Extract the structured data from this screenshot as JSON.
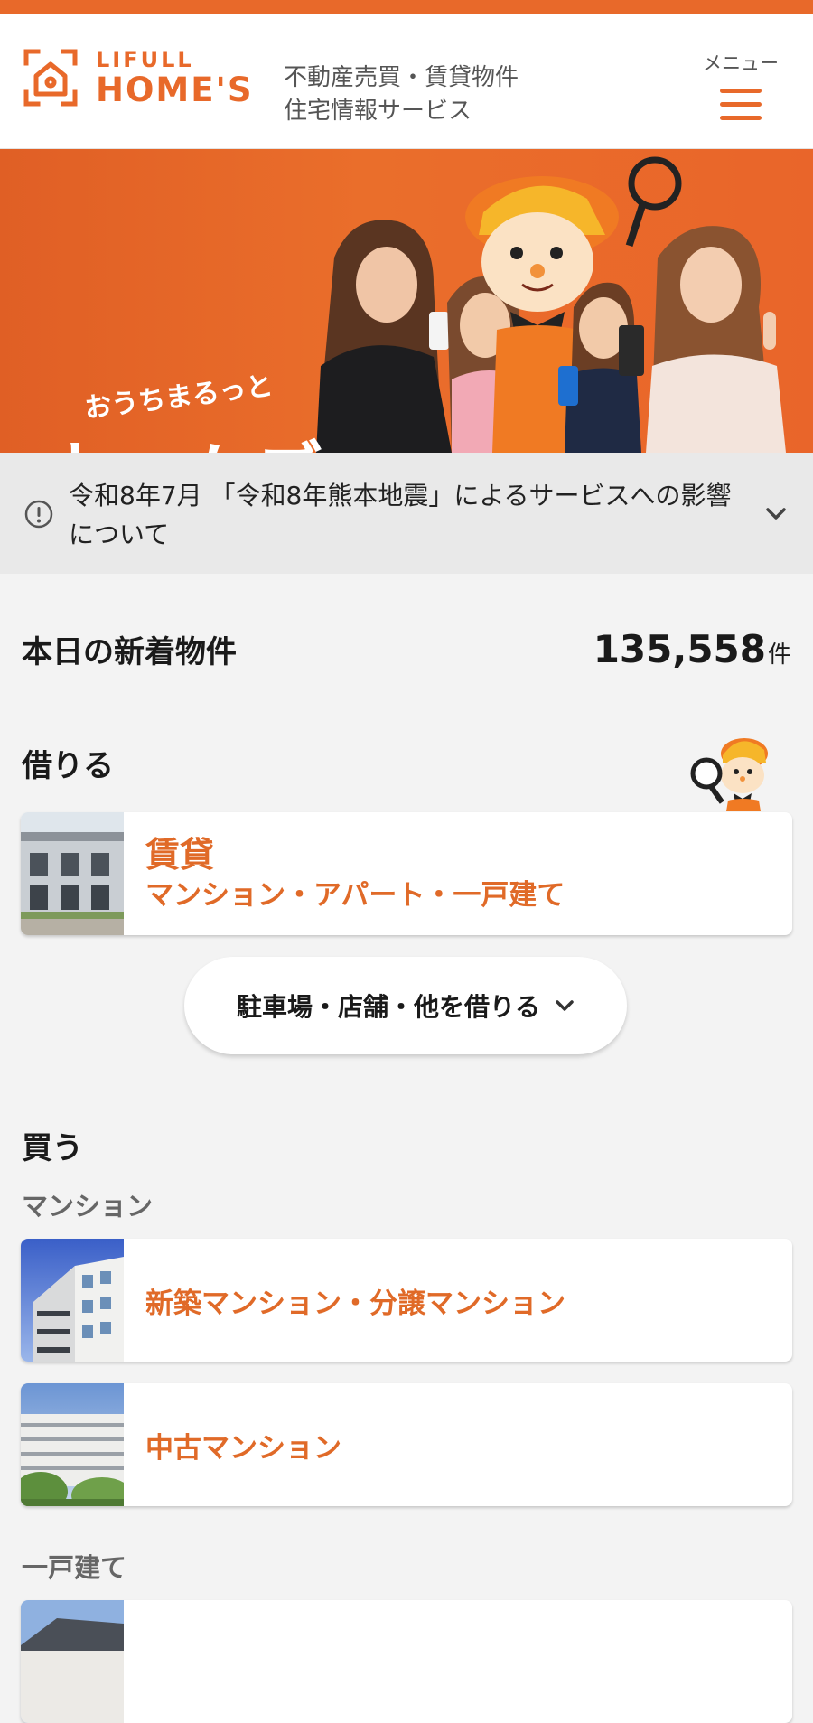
{
  "header": {
    "logo_line1": "LIFULL",
    "logo_line2": "HOME'S",
    "tagline_line1": "不動産売買・賃貸物件",
    "tagline_line2": "住宅情報サービス",
    "menu_label": "メニュー"
  },
  "hero": {
    "small_text": "おうちまるっと",
    "big_text": "ホームズ"
  },
  "notice": {
    "text": "令和8年7月 「令和8年熊本地震」によるサービスへの影響について"
  },
  "new_listings": {
    "label": "本日の新着物件",
    "count": "135,558",
    "unit": "件"
  },
  "rent": {
    "title": "借りる",
    "card_title": "賃貸",
    "card_subtitle": "マンション・アパート・一戸建て",
    "more_button": "駐車場・店舗・他を借りる"
  },
  "buy": {
    "title": "買う",
    "mansion_label": "マンション",
    "new_mansion": "新築マンション・分譲マンション",
    "used_mansion": "中古マンション",
    "house_label": "一戸建て"
  },
  "colors": {
    "brand": "#e8692a",
    "accent_text": "#e06a28"
  }
}
